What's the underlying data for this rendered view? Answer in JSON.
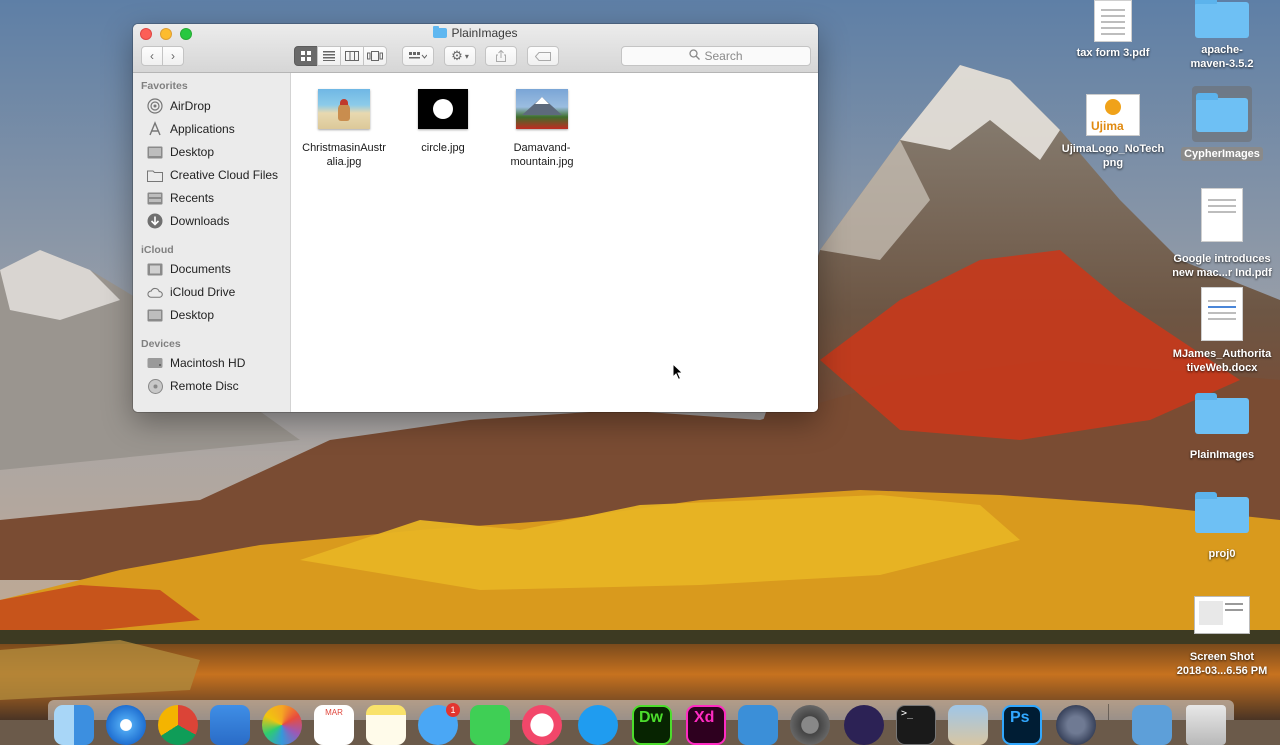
{
  "window": {
    "title": "PlainImages",
    "search_placeholder": "Search"
  },
  "toolbar": {
    "back_icon": "chevron-left-icon",
    "forward_icon": "chevron-right-icon",
    "views": [
      "icon-view-icon",
      "list-view-icon",
      "column-view-icon",
      "cover-flow-icon"
    ],
    "arrange_icon": "arrange-grid-icon",
    "action_icon": "gear-icon",
    "share_icon": "share-icon",
    "tag_icon": "tag-icon"
  },
  "sidebar": {
    "sections": [
      {
        "heading": "Favorites",
        "items": [
          {
            "label": "AirDrop",
            "icon": "airdrop-icon"
          },
          {
            "label": "Applications",
            "icon": "applications-icon"
          },
          {
            "label": "Desktop",
            "icon": "desktop-icon"
          },
          {
            "label": "Creative Cloud Files",
            "icon": "folder-icon"
          },
          {
            "label": "Recents",
            "icon": "recents-icon"
          },
          {
            "label": "Downloads",
            "icon": "downloads-icon"
          }
        ]
      },
      {
        "heading": "iCloud",
        "items": [
          {
            "label": "Documents",
            "icon": "documents-icon"
          },
          {
            "label": "iCloud Drive",
            "icon": "cloud-icon"
          },
          {
            "label": "Desktop",
            "icon": "desktop-icon"
          }
        ]
      },
      {
        "heading": "Devices",
        "items": [
          {
            "label": "Macintosh HD",
            "icon": "hard-drive-icon"
          },
          {
            "label": "Remote Disc",
            "icon": "disc-icon"
          }
        ]
      }
    ]
  },
  "files": [
    {
      "name_line1": "ChristmasinAustr",
      "name_line2": "alia.jpg",
      "thumb": "beach-image-thumbnail"
    },
    {
      "name_line1": "circle.jpg",
      "name_line2": "",
      "thumb": "black-circle-thumbnail"
    },
    {
      "name_line1": "Damavand-",
      "name_line2": "mountain.jpg",
      "thumb": "mountain-image-thumbnail"
    }
  ],
  "desktop_icons": [
    {
      "line1": "tax form 3.pdf",
      "line2": "",
      "kind": "pdf-document-icon"
    },
    {
      "line1": "apache-",
      "line2": "maven-3.5.2",
      "kind": "folder-icon"
    },
    {
      "line1": "UjimaLogo_NoTech",
      "line2": "png",
      "kind": "image-file-icon"
    },
    {
      "line1": "CypherImages",
      "line2": "",
      "kind": "folder-icon"
    },
    {
      "line1": "Google introduces",
      "line2": "new mac...r Ind.pdf",
      "kind": "pdf-document-icon"
    },
    {
      "line1": "MJames_Authorita",
      "line2": "tiveWeb.docx",
      "kind": "word-document-icon"
    },
    {
      "line1": "PlainImages",
      "line2": "",
      "kind": "folder-icon"
    },
    {
      "line1": "proj0",
      "line2": "",
      "kind": "folder-icon"
    },
    {
      "line1": "Screen Shot",
      "line2": "2018-03...6.56 PM",
      "kind": "screenshot-file-icon"
    }
  ],
  "dock": {
    "calendar_month": "MAR",
    "badge_count": "1",
    "app_labels": [
      "Dw",
      "Xd",
      "Ps"
    ]
  }
}
